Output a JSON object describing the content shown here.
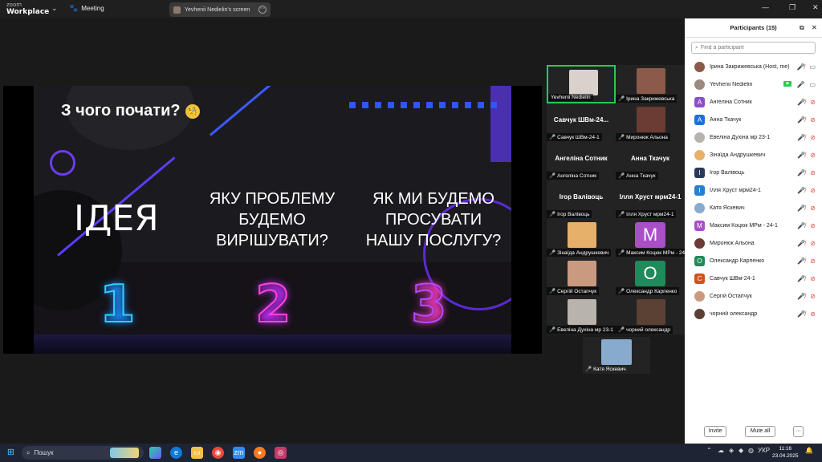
{
  "app": {
    "logo_line1": "zoom",
    "logo_line2": "Workplace",
    "meeting_label": "Meeting",
    "share_indicator": "Yevhenii Nedielin's screen",
    "window_controls": [
      "—",
      "❐",
      "✕"
    ]
  },
  "slide": {
    "title": "З чого почати?",
    "title_emoji": "🧐",
    "big_word": "ІДЕЯ",
    "col2_lines": [
      "ЯКУ ПРОБЛЕМУ",
      "БУДЕМО",
      "ВИРІШУВАТИ?"
    ],
    "col3_lines": [
      "ЯК МИ БУДЕМО",
      "ПРОСУВАТИ",
      "НАШУ ПОСЛУГУ?"
    ],
    "numbers": [
      "1",
      "2",
      "3"
    ]
  },
  "gallery": {
    "tiles": [
      {
        "label": "Yevhenii Nedielin",
        "big": "",
        "type": "photo",
        "color": "#d9d2cc",
        "muted": false,
        "active": true
      },
      {
        "label": "Ірина Закрижевська",
        "big": "",
        "type": "photo",
        "color": "#8b5a4a",
        "muted": true,
        "active": false
      },
      {
        "label": "Савчук ШВм-24-1",
        "big": "Савчук ШВм-24...",
        "type": "name",
        "color": "",
        "muted": true,
        "active": false
      },
      {
        "label": "Миронюк Альона",
        "big": "",
        "type": "photo",
        "color": "#6b3c34",
        "muted": true,
        "active": false
      },
      {
        "label": "Ангеліна Сотник",
        "big": "Ангеліна Сотник",
        "type": "name",
        "color": "",
        "muted": true,
        "active": false
      },
      {
        "label": "Анна Ткачук",
        "big": "Анна Ткачук",
        "type": "name",
        "color": "",
        "muted": true,
        "active": false
      },
      {
        "label": "Ігор Валівоць",
        "big": "Ігор Валівоць",
        "type": "name",
        "color": "",
        "muted": true,
        "active": false
      },
      {
        "label": "Ілля Хруст мрм24-1",
        "big": "Ілля Хруст мрм24-1",
        "type": "name",
        "color": "",
        "muted": true,
        "active": false
      },
      {
        "label": "Зінаїда Андрушкевич",
        "big": "",
        "type": "photo",
        "color": "#e6b06a",
        "muted": true,
        "active": false
      },
      {
        "label": "Максим Коцюк МРм - 24-1",
        "big": "",
        "type": "letter",
        "letter": "M",
        "color": "#a94fc8",
        "muted": true,
        "active": false
      },
      {
        "label": "Сергій Остапчук",
        "big": "",
        "type": "photo",
        "color": "#c99a80",
        "muted": true,
        "active": false
      },
      {
        "label": "Олександр Карпенко",
        "big": "",
        "type": "letter",
        "letter": "O",
        "color": "#1f8a5a",
        "muted": true,
        "active": false
      },
      {
        "label": "Евеліна Духіна мр 23-1",
        "big": "",
        "type": "photo",
        "color": "#b8b3ad",
        "muted": true,
        "active": false
      },
      {
        "label": "чорний олександр",
        "big": "",
        "type": "photo",
        "color": "#5b4034",
        "muted": true,
        "active": false
      }
    ],
    "self_tile": {
      "label": "Катя Яскевич"
    }
  },
  "participants": {
    "title": "Participants (15)",
    "search_placeholder": "Find a participant",
    "items": [
      {
        "name": "Ірина Закрижевська (Host, me)",
        "avatar": "photo",
        "letter": "",
        "color": "#8b5a4a",
        "sharing": false,
        "mic_muted": true,
        "video_off": false
      },
      {
        "name": "Yevhenii Nedielin",
        "avatar": "photo",
        "letter": "",
        "color": "#9a8a80",
        "sharing": true,
        "mic_muted": false,
        "video_off": false
      },
      {
        "name": "Ангеліна Сотник",
        "avatar": "letter",
        "letter": "A",
        "color": "#8e4ec6",
        "sharing": false,
        "mic_muted": true,
        "video_off": true
      },
      {
        "name": "Анна Ткачук",
        "avatar": "letter",
        "letter": "A",
        "color": "#1e6fd9",
        "sharing": false,
        "mic_muted": true,
        "video_off": true
      },
      {
        "name": "Евеліна Духіна мр 23-1",
        "avatar": "photo",
        "letter": "",
        "color": "#b8b3ad",
        "sharing": false,
        "mic_muted": true,
        "video_off": true
      },
      {
        "name": "Зінаїда Андрушкевич",
        "avatar": "photo",
        "letter": "",
        "color": "#e6b06a",
        "sharing": false,
        "mic_muted": true,
        "video_off": true
      },
      {
        "name": "Ігор Валівоць",
        "avatar": "letter",
        "letter": "I",
        "color": "#2a3a5a",
        "sharing": false,
        "mic_muted": true,
        "video_off": true
      },
      {
        "name": "Ілля Хруст мрм24-1",
        "avatar": "letter",
        "letter": "I",
        "color": "#2a7fc8",
        "sharing": false,
        "mic_muted": true,
        "video_off": true
      },
      {
        "name": "Катя Яскевич",
        "avatar": "photo",
        "letter": "",
        "color": "#88aacc",
        "sharing": false,
        "mic_muted": true,
        "video_off": true
      },
      {
        "name": "Максим Коцюк МРм - 24-1",
        "avatar": "letter",
        "letter": "M",
        "color": "#a94fc8",
        "sharing": false,
        "mic_muted": true,
        "video_off": true
      },
      {
        "name": "Миронюк Альона",
        "avatar": "photo",
        "letter": "",
        "color": "#6b3c34",
        "sharing": false,
        "mic_muted": true,
        "video_off": true
      },
      {
        "name": "Олександр Карпенко",
        "avatar": "letter",
        "letter": "O",
        "color": "#1f8a5a",
        "sharing": false,
        "mic_muted": true,
        "video_off": true
      },
      {
        "name": "Савчук ШВм-24-1",
        "avatar": "letter",
        "letter": "C",
        "color": "#d2521f",
        "sharing": false,
        "mic_muted": true,
        "video_off": true
      },
      {
        "name": "Сергій Остапчук",
        "avatar": "photo",
        "letter": "",
        "color": "#c99a80",
        "sharing": false,
        "mic_muted": true,
        "video_off": true
      },
      {
        "name": "чорний олександр",
        "avatar": "photo",
        "letter": "",
        "color": "#5b4034",
        "sharing": false,
        "mic_muted": true,
        "video_off": true
      }
    ],
    "invite_label": "Invite",
    "mute_all_label": "Mute all",
    "more_label": "···"
  },
  "taskbar": {
    "search_text": "Пошук",
    "lang": "УКР",
    "time": "11:16",
    "date": "23.04.2025"
  }
}
